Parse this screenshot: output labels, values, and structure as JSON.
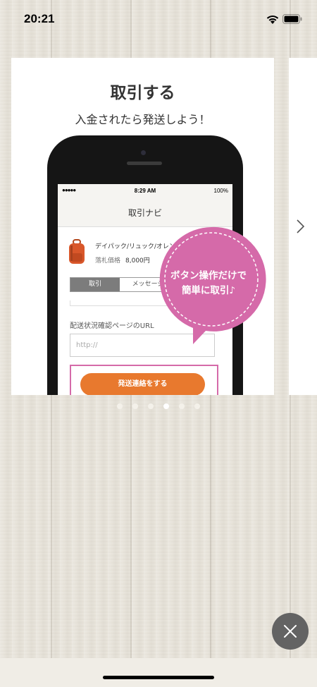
{
  "status_bar": {
    "time": "20:21"
  },
  "slide": {
    "title": "取引する",
    "subtitle": "入金されたら発送しよう！",
    "phone": {
      "status_carrier": "●●●●● ",
      "status_time": "8:29 AM",
      "status_battery": "100%",
      "nav_title": "取引ナビ",
      "item_name": "デイパック/リュック/オレンジ",
      "price_label": "落札価格",
      "price_value": "8,000円",
      "tabs": [
        "取引",
        "メッセージ"
      ],
      "url_label": "配送状況確認ページのURL",
      "url_placeholder": "http://",
      "ship_button": "発送連絡をする"
    },
    "bubble_lines": [
      "ボタン操作だけで",
      "簡単に取引♪"
    ]
  },
  "pager": {
    "count": 6,
    "active_index": 3
  },
  "colors": {
    "accent_orange": "#e8792e",
    "bubble_pink": "#d56aa9",
    "close_button": "#636363"
  },
  "icons": {
    "next": "chevron-right-icon",
    "close": "close-icon",
    "wifi": "wifi-icon",
    "battery": "battery-icon"
  }
}
